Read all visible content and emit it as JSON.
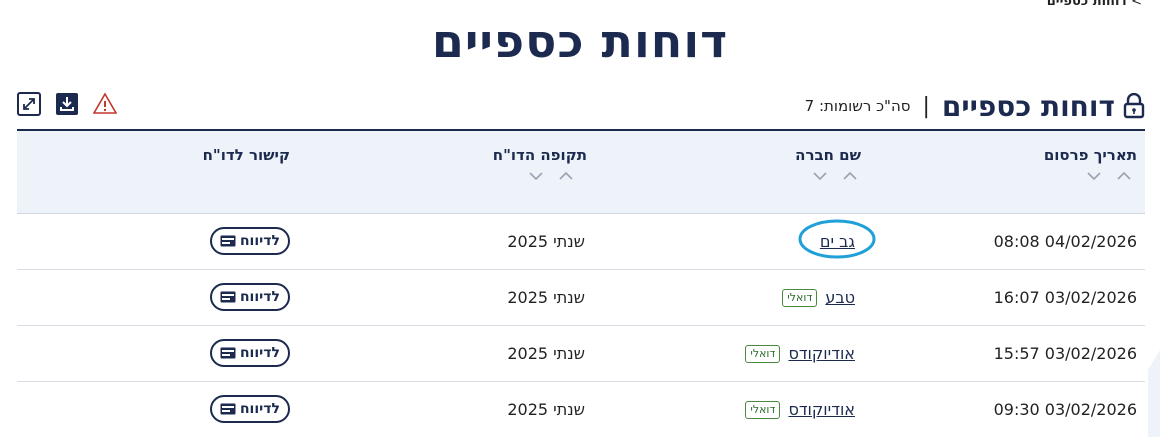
{
  "breadcrumb": {
    "separator": ">",
    "current": "דוחות כספיים"
  },
  "page": {
    "title": "דוחות כספיים"
  },
  "section": {
    "title": "דוחות כספיים",
    "divider": "|",
    "total_label": "סה\"כ רשומות: 7"
  },
  "toolbar": {
    "icons": [
      "lock-icon",
      "warning-icon",
      "download-icon",
      "expand-icon"
    ]
  },
  "table": {
    "columns": [
      "תאריך פרסום",
      "שם חברה",
      "תקופה הדו\"ח",
      "קישור לדו\"ח"
    ],
    "rows": [
      {
        "date": "04/02/2026 08:08",
        "company": "גב ים",
        "tag": "",
        "period": "שנתי 2025",
        "link_label": "לדיווח"
      },
      {
        "date": "03/02/2026 16:07",
        "company": "טבע",
        "tag": "דואלי",
        "period": "שנתי 2025",
        "link_label": "לדיווח"
      },
      {
        "date": "03/02/2026 15:57",
        "company": "אודיוקודס",
        "tag": "דואלי",
        "period": "שנתי 2025",
        "link_label": "לדיווח"
      },
      {
        "date": "03/02/2026 09:30",
        "company": "אודיוקודס",
        "tag": "דואלי",
        "period": "שנתי 2025",
        "link_label": "לדיווח"
      }
    ]
  },
  "colors": {
    "navy": "#1b2a4e",
    "header_bg": "#eef3fa",
    "tag_green": "#4a8a3f",
    "warning": "#c0392b",
    "highlight": "#1fa0d8"
  }
}
